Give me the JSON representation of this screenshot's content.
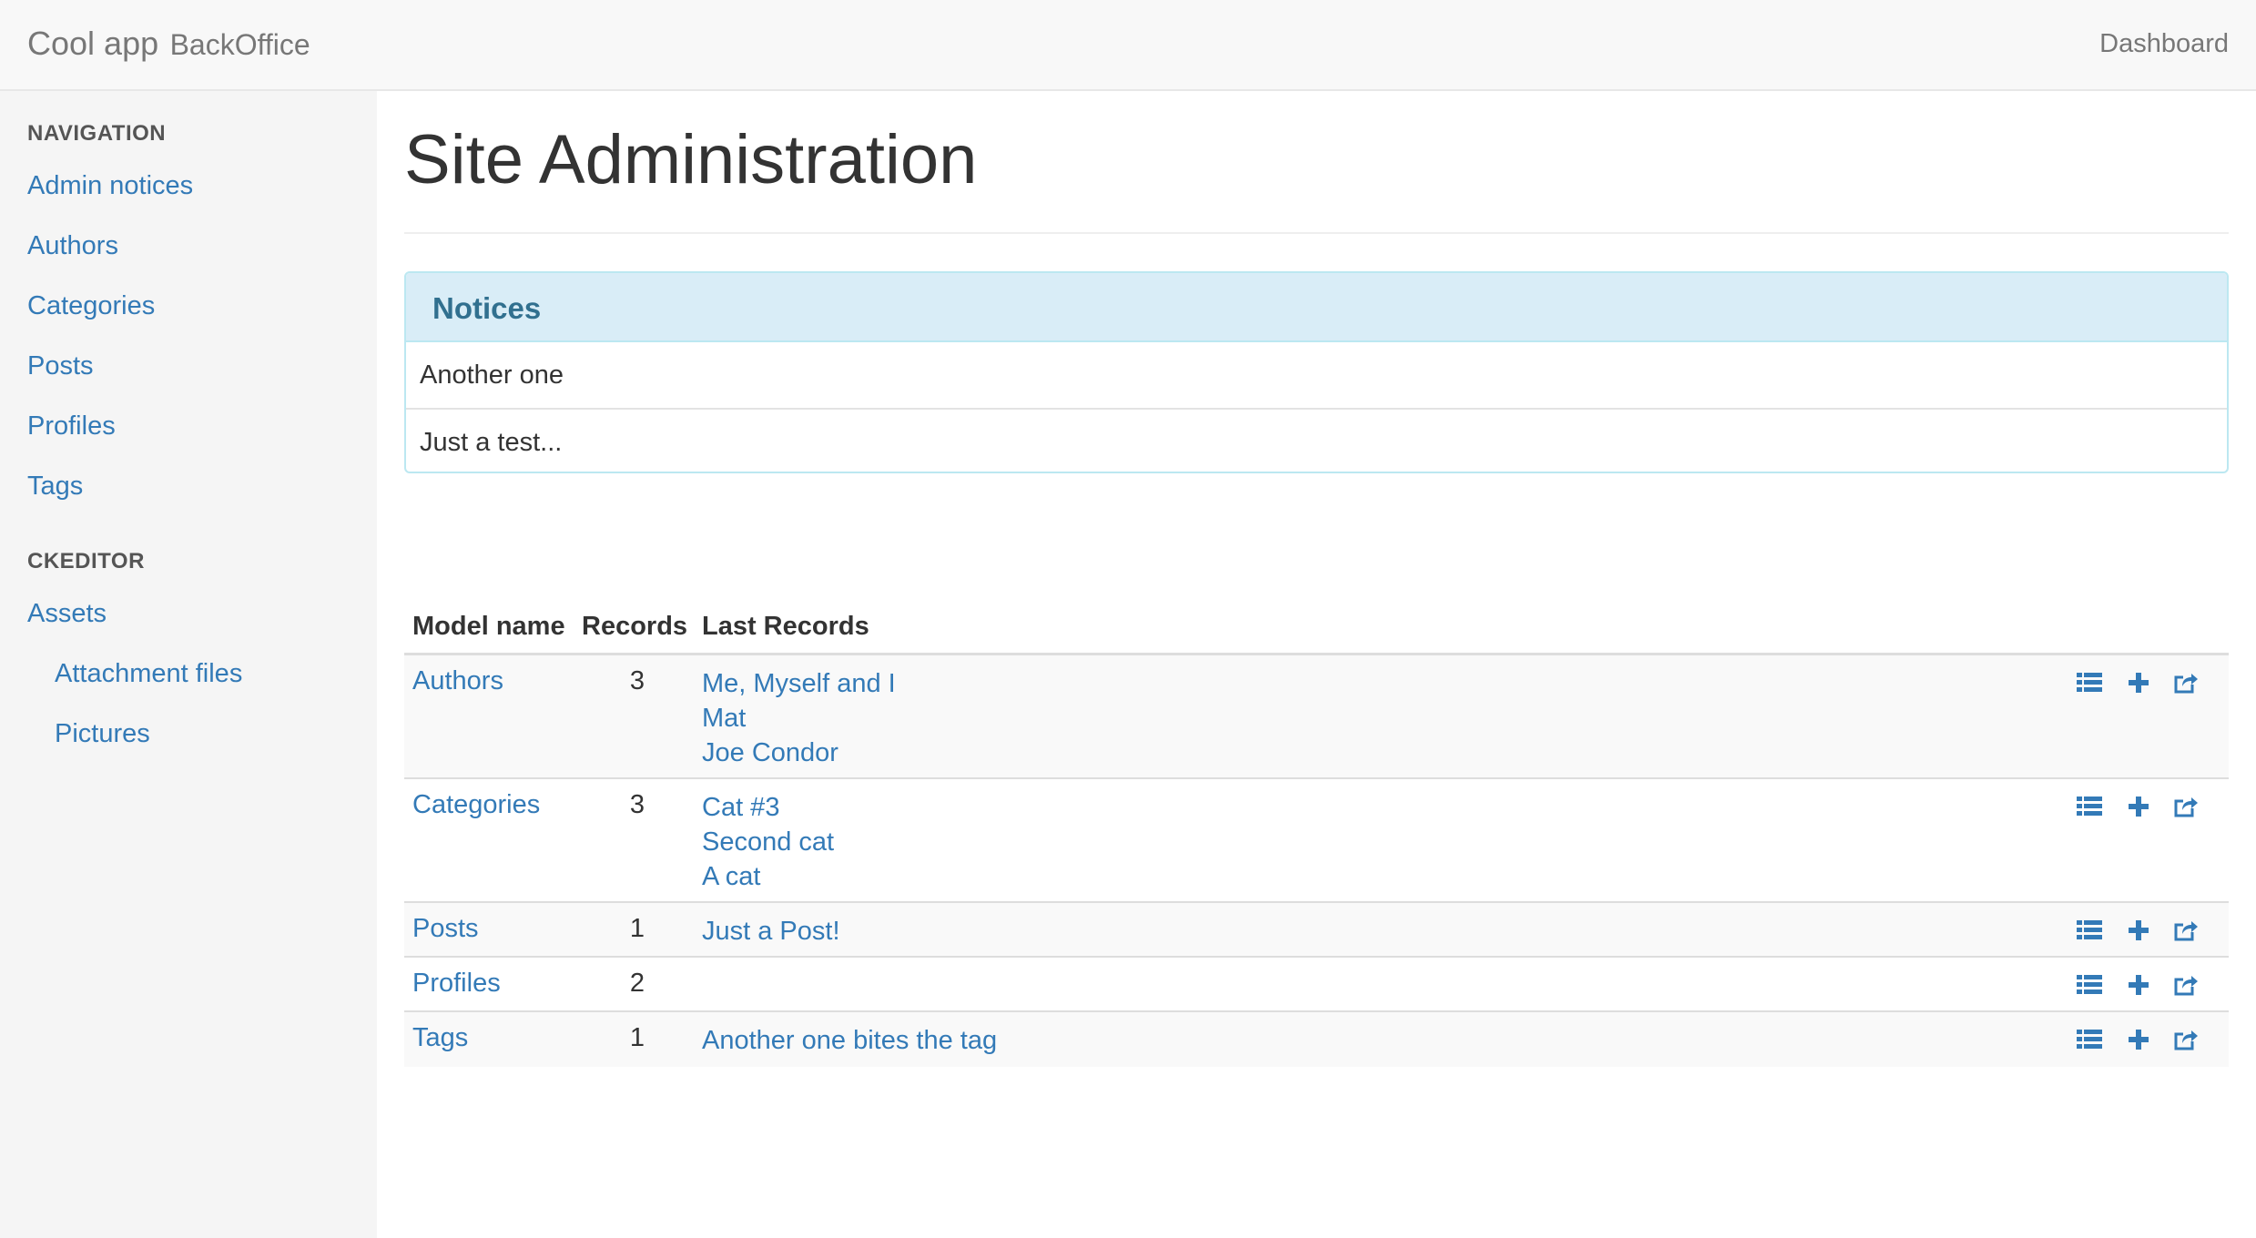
{
  "navbar": {
    "app_name": "Cool app",
    "subtitle": "BackOffice",
    "dashboard_label": "Dashboard"
  },
  "sidebar": {
    "navigation_header": "NAVIGATION",
    "nav_items": [
      {
        "label": "Admin notices"
      },
      {
        "label": "Authors"
      },
      {
        "label": "Categories"
      },
      {
        "label": "Posts"
      },
      {
        "label": "Profiles"
      },
      {
        "label": "Tags"
      }
    ],
    "ckeditor_header": "CKEDITOR",
    "ckeditor_items": [
      {
        "label": "Assets"
      },
      {
        "label": "Attachment files"
      },
      {
        "label": "Pictures"
      }
    ]
  },
  "main": {
    "title": "Site Administration",
    "notices": {
      "heading": "Notices",
      "items": [
        "Another one",
        "Just a test..."
      ]
    },
    "table": {
      "headers": {
        "model_name": "Model name",
        "records": "Records",
        "last_records": "Last Records"
      },
      "rows": [
        {
          "name": "Authors",
          "count": "3",
          "last": [
            "Me, Myself and I",
            "Mat",
            "Joe Condor"
          ]
        },
        {
          "name": "Categories",
          "count": "3",
          "last": [
            "Cat #3",
            "Second cat",
            "A cat"
          ]
        },
        {
          "name": "Posts",
          "count": "1",
          "last": [
            "Just a Post!"
          ]
        },
        {
          "name": "Profiles",
          "count": "2",
          "last": []
        },
        {
          "name": "Tags",
          "count": "1",
          "last": [
            "Another one bites the tag"
          ]
        }
      ]
    }
  },
  "colors": {
    "link": "#337ab7",
    "panel_info_bg": "#d9edf7",
    "panel_info_text": "#31708f",
    "sidebar_bg": "#f5f5f5",
    "navbar_bg": "#f8f8f8"
  },
  "icons": [
    "list-icon",
    "plus-icon",
    "share-icon"
  ]
}
